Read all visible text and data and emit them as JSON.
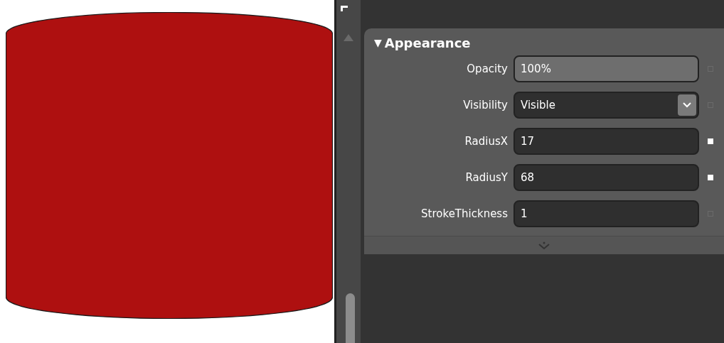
{
  "section": {
    "arrow": "▼",
    "title": "Appearance",
    "expanded": true
  },
  "properties": [
    {
      "label": "Opacity",
      "kind": "spinner",
      "value": "100%",
      "local": false
    },
    {
      "label": "Visibility",
      "kind": "dropdown",
      "value": "Visible",
      "local": false
    },
    {
      "label": "RadiusX",
      "kind": "text",
      "value": "17",
      "local": true
    },
    {
      "label": "RadiusY",
      "kind": "text",
      "value": "68",
      "local": true
    },
    {
      "label": "StrokeThickness",
      "kind": "text",
      "value": "1",
      "local": false
    }
  ]
}
